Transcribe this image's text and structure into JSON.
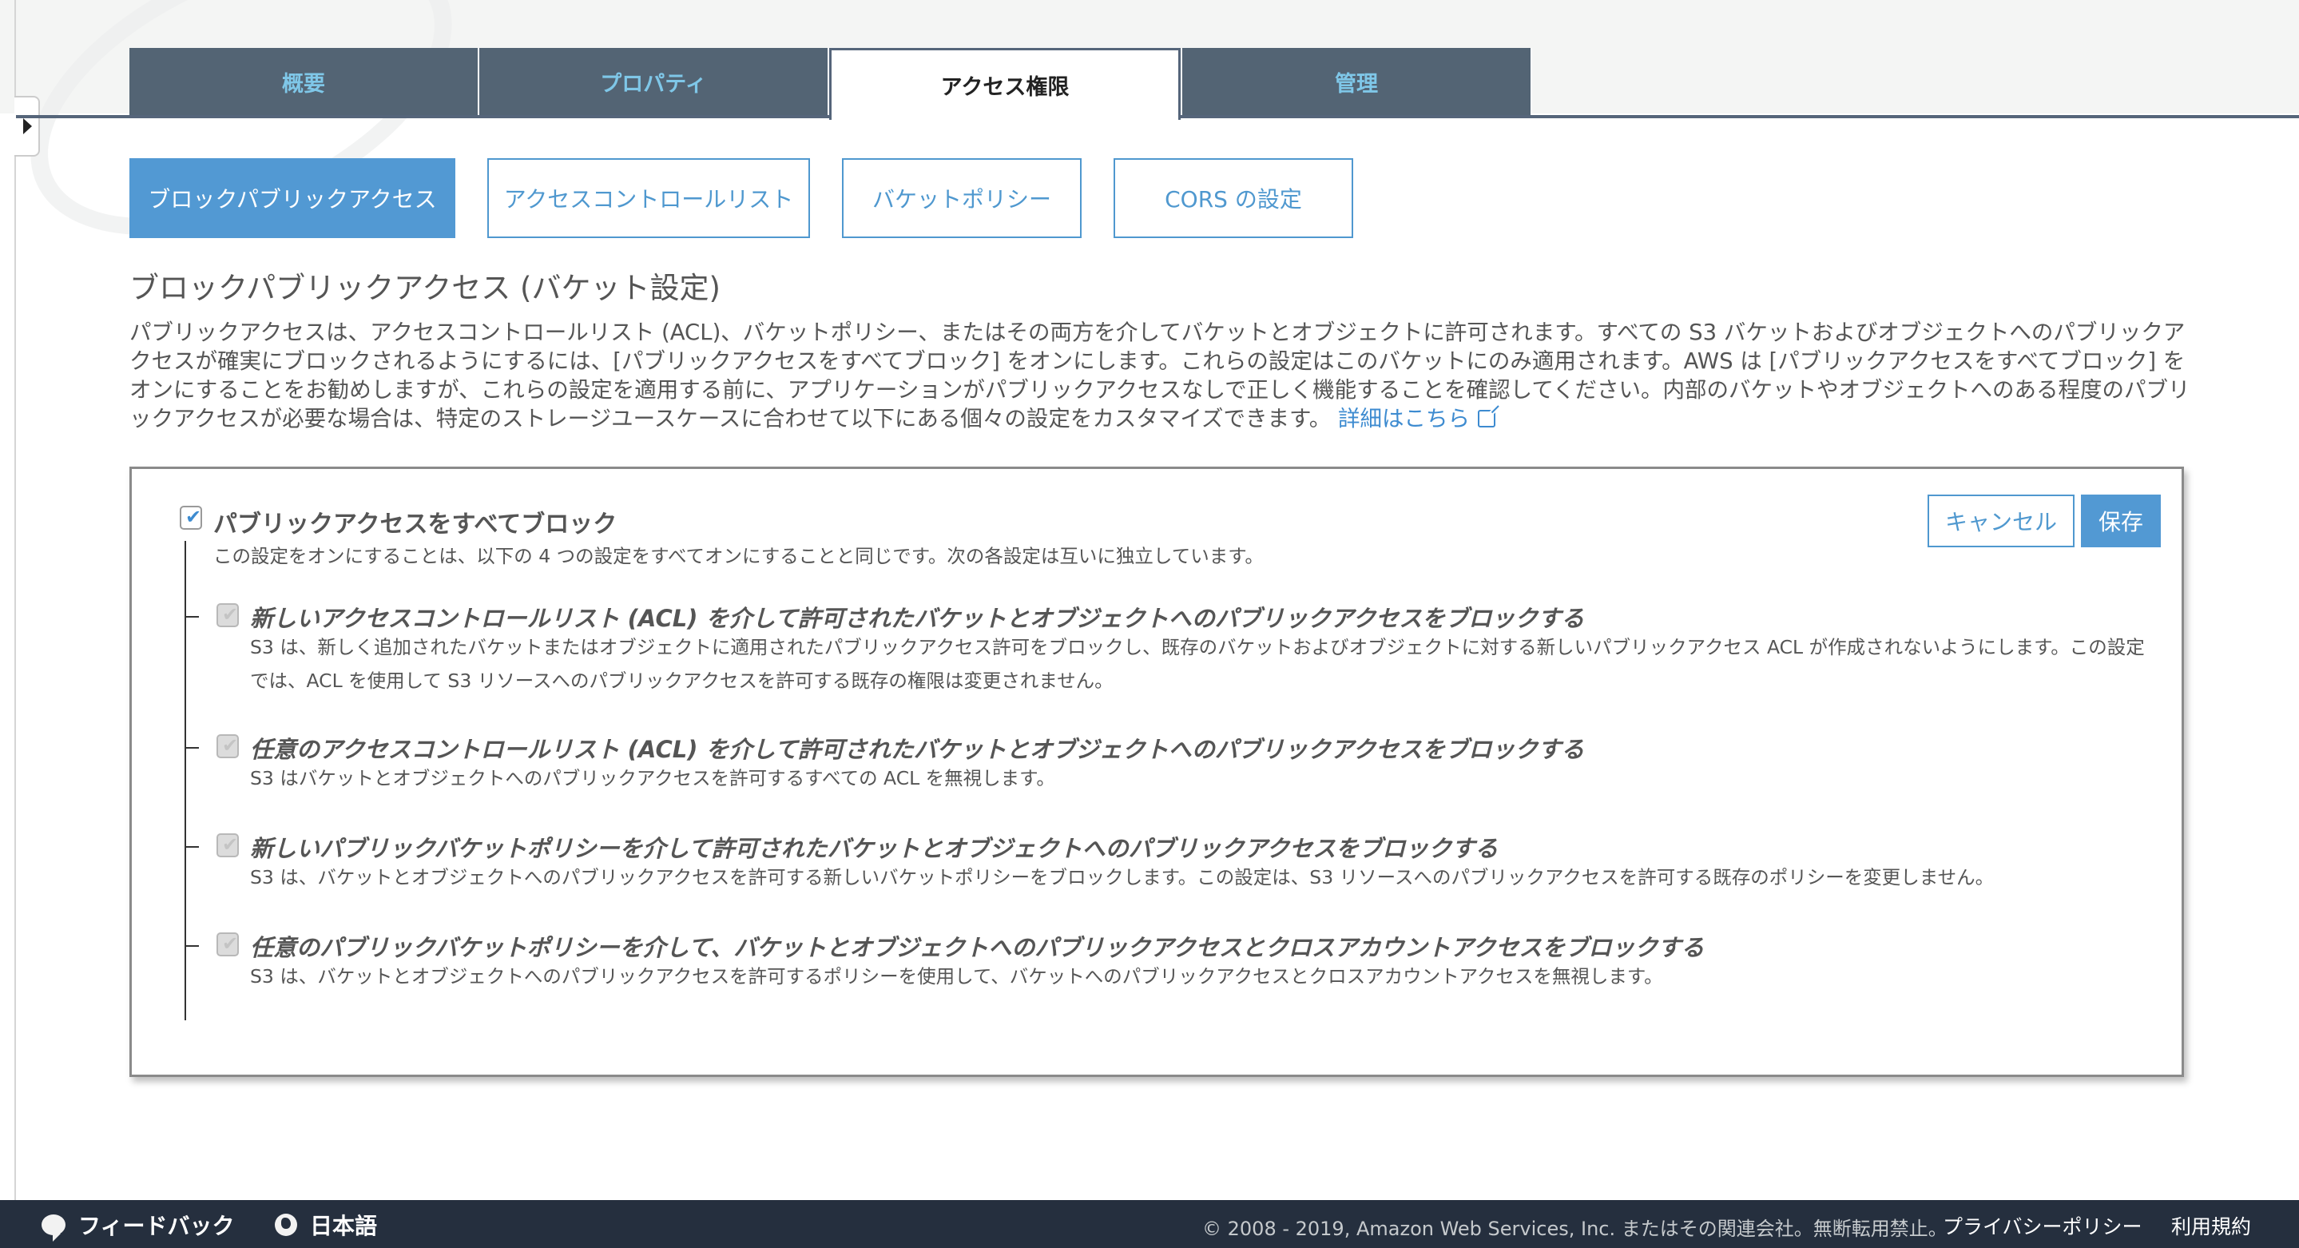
{
  "tabs": [
    {
      "label": "概要",
      "active": false
    },
    {
      "label": "プロパティ",
      "active": false
    },
    {
      "label": "アクセス権限",
      "active": true
    },
    {
      "label": "管理",
      "active": false
    }
  ],
  "subtabs": [
    {
      "label": "ブロックパブリックアクセス",
      "active": true
    },
    {
      "label": "アクセスコントロールリスト",
      "active": false
    },
    {
      "label": "バケットポリシー",
      "active": false
    },
    {
      "label": "CORS の設定",
      "active": false
    }
  ],
  "section": {
    "title": "ブロックパブリックアクセス (バケット設定)",
    "description": "パブリックアクセスは、アクセスコントロールリスト (ACL)、バケットポリシー、またはその両方を介してバケットとオブジェクトに許可されます。すべての S3 バケットおよびオブジェクトへのパブリックアクセスが確実にブロックされるようにするには、[パブリックアクセスをすべてブロック] をオンにします。これらの設定はこのバケットにのみ適用されます。AWS は [パブリックアクセスをすべてブロック] をオンにすることをお勧めしますが、これらの設定を適用する前に、アプリケーションがパブリックアクセスなしで正しく機能することを確認してください。内部のバケットやオブジェクトへのある程度のパブリックアクセスが必要な場合は、特定のストレージユースケースに合わせて以下にある個々の設定をカスタマイズできます。",
    "learn_more_link": "詳細はこちら",
    "learn_more_icon": "external-link-icon"
  },
  "settings": {
    "cancel_label": "キャンセル",
    "save_label": "保存",
    "master": {
      "label": "パブリックアクセスをすべてブロック",
      "description": "この設定をオンにすることは、以下の 4 つの設定をすべてオンにすることと同じです。次の各設定は互いに独立しています。",
      "checked": true
    },
    "items": [
      {
        "label": "新しいアクセスコントロールリスト (ACL) を介して許可されたバケットとオブジェクトへのパブリックアクセスをブロックする",
        "description": "S3 は、新しく追加されたバケットまたはオブジェクトに適用されたパブリックアクセス許可をブロックし、既存のバケットおよびオブジェクトに対する新しいパブリックアクセス ACL が作成されないようにします。この設定では、ACL を使用して S3 リソースへのパブリックアクセスを許可する既存の権限は変更されません。",
        "checked": true,
        "disabled": true
      },
      {
        "label": "任意のアクセスコントロールリスト (ACL) を介して許可されたバケットとオブジェクトへのパブリックアクセスをブロックする",
        "description": "S3 はバケットとオブジェクトへのパブリックアクセスを許可するすべての ACL を無視します。",
        "checked": true,
        "disabled": true
      },
      {
        "label": "新しいパブリックバケットポリシーを介して許可されたバケットとオブジェクトへのパブリックアクセスをブロックする",
        "description": "S3 は、バケットとオブジェクトへのパブリックアクセスを許可する新しいバケットポリシーをブロックします。この設定は、S3 リソースへのパブリックアクセスを許可する既存のポリシーを変更しません。",
        "checked": true,
        "disabled": true
      },
      {
        "label": "任意のパブリックバケットポリシーを介して、バケットとオブジェクトへのパブリックアクセスとクロスアカウントアクセスをブロックする",
        "description": "S3 は、バケットとオブジェクトへのパブリックアクセスを許可するポリシーを使用して、バケットへのパブリックアクセスとクロスアカウントアクセスを無視します。",
        "checked": true,
        "disabled": true
      }
    ]
  },
  "footer": {
    "feedback_label": "フィードバック",
    "feedback_icon": "speech-bubble-icon",
    "language_label": "日本語",
    "language_icon": "globe-icon",
    "copyright": "© 2008 - 2019, Amazon Web Services, Inc. またはその関連会社。無断転用禁止。",
    "privacy_label": "プライバシーポリシー",
    "terms_label": "利用規約"
  },
  "colors": {
    "accent": "#5299d3",
    "tab_bg": "#536474",
    "tab_text": "#7fc7e8",
    "footer_bg": "#252f3e"
  }
}
